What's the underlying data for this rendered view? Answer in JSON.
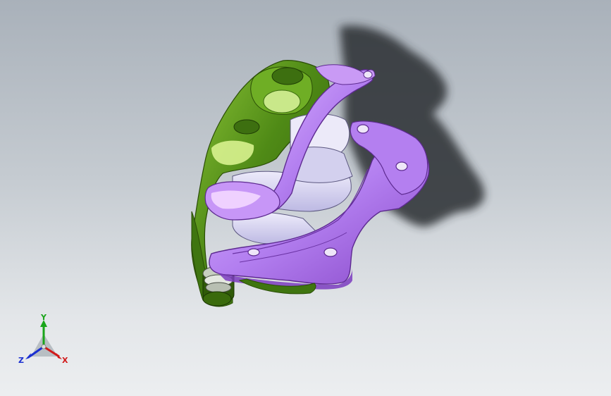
{
  "viewport": {
    "background_top": "#a9b1ba",
    "background_bottom": "#eceef0"
  },
  "model": {
    "parts": [
      {
        "name": "caliper-body",
        "color": "#4f8a16"
      },
      {
        "name": "bracket",
        "color": "#a86ee0"
      },
      {
        "name": "brake-pads",
        "color": "#d8d6f2"
      },
      {
        "name": "shadow",
        "color": "#2a2d33"
      }
    ]
  },
  "triad": {
    "x_label": "X",
    "y_label": "Y",
    "z_label": "Z",
    "x_color": "#d11a1a",
    "y_color": "#1aa51a",
    "z_color": "#1a2fd1"
  }
}
